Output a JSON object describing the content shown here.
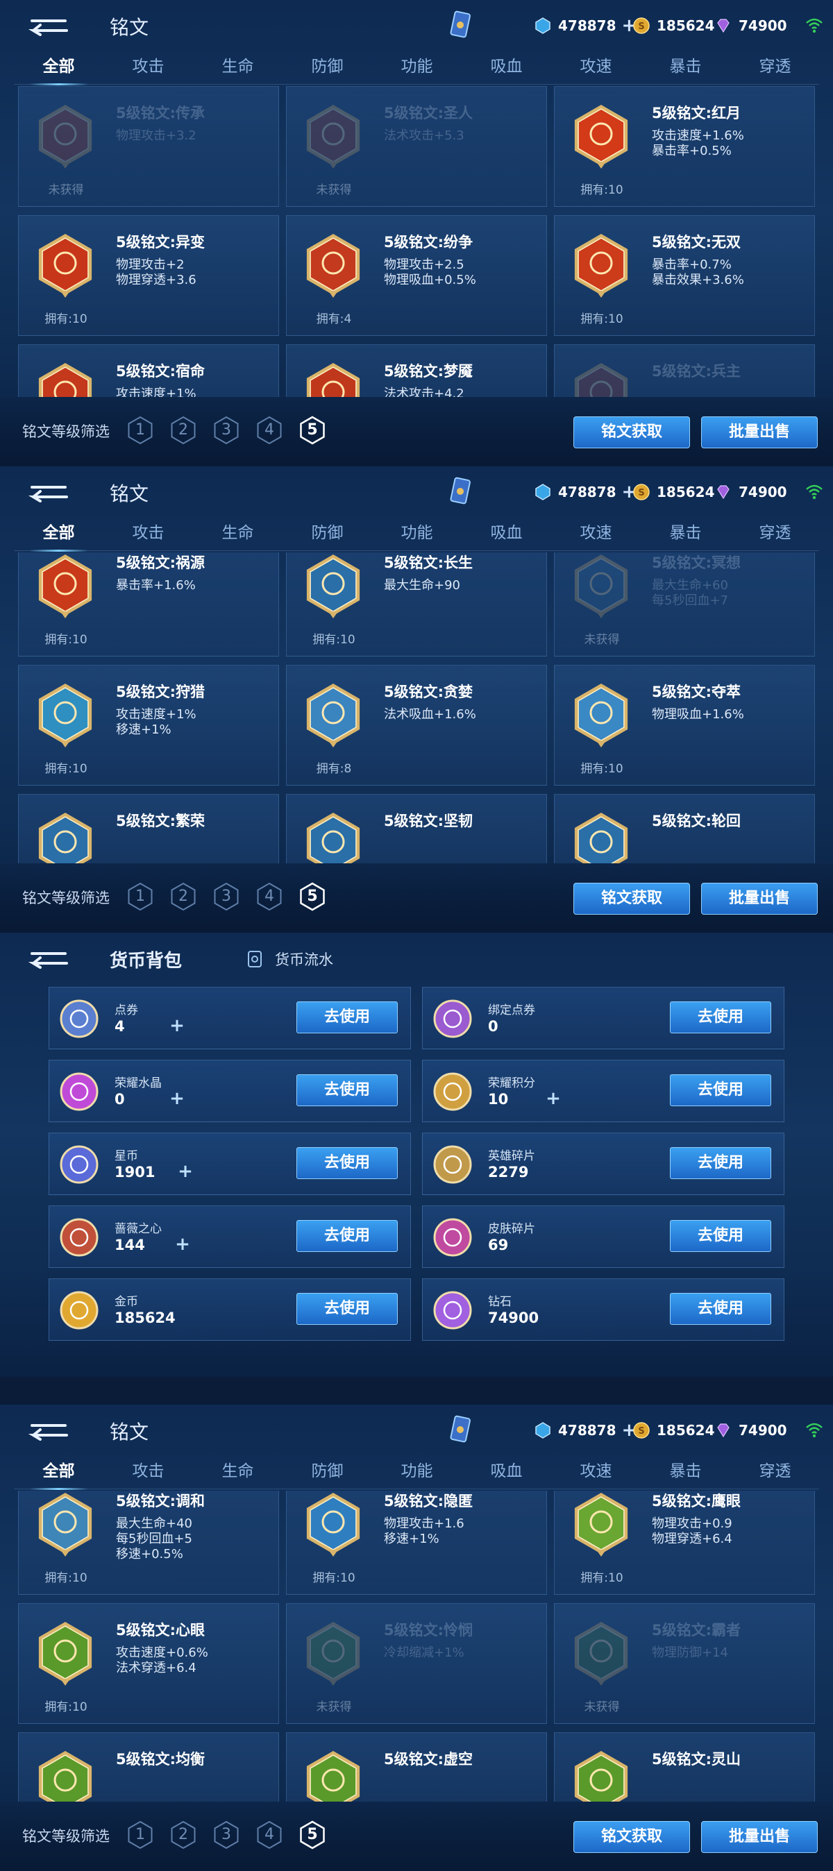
{
  "header": {
    "title": "铭文",
    "gems": "478878",
    "gold": "185624",
    "diamonds": "74900"
  },
  "tabs": [
    "全部",
    "攻击",
    "生命",
    "防御",
    "功能",
    "吸血",
    "攻速",
    "暴击",
    "穿透"
  ],
  "bottom": {
    "filter_label": "铭文等级筛选",
    "levels": [
      "1",
      "2",
      "3",
      "4",
      "5"
    ],
    "selected_level": "5",
    "acquire": "铭文获取",
    "sell": "批量出售"
  },
  "panels": [
    {
      "cards": [
        {
          "name": "5级铭文:传承",
          "stats": [
            "物理攻击+3.2"
          ],
          "own": "未获得",
          "owned": false,
          "color": "#b03a24"
        },
        {
          "name": "5级铭文:圣人",
          "stats": [
            "法术攻击+5.3"
          ],
          "own": "未获得",
          "owned": false,
          "color": "#a03a30"
        },
        {
          "name": "5级铭文:红月",
          "stats": [
            "攻击速度+1.6%",
            "暴击率+0.5%"
          ],
          "own": "拥有:10",
          "owned": true,
          "color": "#d23a18"
        },
        {
          "name": "5级铭文:异变",
          "stats": [
            "物理攻击+2",
            "物理穿透+3.6"
          ],
          "own": "拥有:10",
          "owned": true,
          "color": "#c8361a"
        },
        {
          "name": "5级铭文:纷争",
          "stats": [
            "物理攻击+2.5",
            "物理吸血+0.5%"
          ],
          "own": "拥有:4",
          "owned": true,
          "color": "#c33a1e"
        },
        {
          "name": "5级铭文:无双",
          "stats": [
            "暴击率+0.7%",
            "暴击效果+3.6%"
          ],
          "own": "拥有:10",
          "owned": true,
          "color": "#cc3b1a"
        },
        {
          "name": "5级铭文:宿命",
          "stats": [
            "攻击速度+1%"
          ],
          "own": "",
          "owned": true,
          "color": "#c4381c"
        },
        {
          "name": "5级铭文:梦魇",
          "stats": [
            "法术攻击+4.2"
          ],
          "own": "",
          "owned": true,
          "color": "#c0381c"
        },
        {
          "name": "5级铭文:兵主",
          "stats": [
            ""
          ],
          "own": "",
          "owned": false,
          "color": "#a03a30"
        }
      ]
    },
    {
      "cards": [
        {
          "name": "5级铭文:祸源",
          "stats": [
            "暴击率+1.6%"
          ],
          "own": "拥有:10",
          "owned": true,
          "color": "#c93a1a"
        },
        {
          "name": "5级铭文:长生",
          "stats": [
            "最大生命+90"
          ],
          "own": "拥有:10",
          "owned": true,
          "color": "#2a6fa8"
        },
        {
          "name": "5级铭文:冥想",
          "stats": [
            "最大生命+60",
            "每5秒回血+7"
          ],
          "own": "未获得",
          "owned": false,
          "color": "#2f6a9c"
        },
        {
          "name": "5级铭文:狩猎",
          "stats": [
            "攻击速度+1%",
            "移速+1%"
          ],
          "own": "拥有:10",
          "owned": true,
          "color": "#2e8fc0"
        },
        {
          "name": "5级铭文:贪婪",
          "stats": [
            "法术吸血+1.6%"
          ],
          "own": "拥有:8",
          "owned": true,
          "color": "#3a84c0"
        },
        {
          "name": "5级铭文:夺萃",
          "stats": [
            "物理吸血+1.6%"
          ],
          "own": "拥有:10",
          "owned": true,
          "color": "#3a88c4"
        },
        {
          "name": "5级铭文:繁荣",
          "stats": [
            ""
          ],
          "own": "",
          "owned": true,
          "color": "#2a6fa8"
        },
        {
          "name": "5级铭文:坚韧",
          "stats": [
            ""
          ],
          "own": "",
          "owned": true,
          "color": "#2a6fa8"
        },
        {
          "name": "5级铭文:轮回",
          "stats": [
            ""
          ],
          "own": "",
          "owned": true,
          "color": "#2a6fa8"
        }
      ]
    },
    {
      "cards": [
        {
          "name": "5级铭文:调和",
          "stats": [
            "最大生命+40",
            "每5秒回血+5",
            "移速+0.5%"
          ],
          "own": "拥有:10",
          "owned": true,
          "color": "#3f86b8"
        },
        {
          "name": "5级铭文:隐匿",
          "stats": [
            "物理攻击+1.6",
            "移速+1%"
          ],
          "own": "拥有:10",
          "owned": true,
          "color": "#2f7fc0"
        },
        {
          "name": "5级铭文:鹰眼",
          "stats": [
            "物理攻击+0.9",
            "物理穿透+6.4"
          ],
          "own": "拥有:10",
          "owned": true,
          "color": "#6aa632"
        },
        {
          "name": "5级铭文:心眼",
          "stats": [
            "攻击速度+0.6%",
            "法术穿透+6.4"
          ],
          "own": "拥有:10",
          "owned": true,
          "color": "#5a9a2a"
        },
        {
          "name": "5级铭文:怜悯",
          "stats": [
            "冷却缩减+1%"
          ],
          "own": "未获得",
          "owned": false,
          "color": "#4a8a3a"
        },
        {
          "name": "5级铭文:霸者",
          "stats": [
            "物理防御+14"
          ],
          "own": "未获得",
          "owned": false,
          "color": "#3e7a3a"
        },
        {
          "name": "5级铭文:均衡",
          "stats": [
            ""
          ],
          "own": "",
          "owned": true,
          "color": "#5a9a2a"
        },
        {
          "name": "5级铭文:虚空",
          "stats": [
            ""
          ],
          "own": "",
          "owned": true,
          "color": "#5a9a2a"
        },
        {
          "name": "5级铭文:灵山",
          "stats": [
            ""
          ],
          "own": "",
          "owned": true,
          "color": "#5a9a2a"
        }
      ]
    }
  ],
  "wallet": {
    "title": "货币背包",
    "flow": "货币流水",
    "use_label": "去使用",
    "items": [
      {
        "name": "点券",
        "value": "4",
        "plus": true,
        "icon": "coupon-icon",
        "color": "#5a7fd0"
      },
      {
        "name": "绑定点券",
        "value": "0",
        "plus": false,
        "icon": "bound-coupon-icon",
        "color": "#9a5ad0"
      },
      {
        "name": "荣耀水晶",
        "value": "0",
        "plus": true,
        "icon": "glory-crystal-icon",
        "color": "#c04ad8"
      },
      {
        "name": "荣耀积分",
        "value": "10",
        "plus": true,
        "icon": "glory-points-icon",
        "color": "#d0a040"
      },
      {
        "name": "星币",
        "value": "1901",
        "plus": true,
        "icon": "star-coin-icon",
        "color": "#5a6ad8"
      },
      {
        "name": "英雄碎片",
        "value": "2279",
        "plus": false,
        "icon": "hero-fragment-icon",
        "color": "#c09a4a"
      },
      {
        "name": "蔷薇之心",
        "value": "144",
        "plus": true,
        "icon": "rose-heart-icon",
        "color": "#c0503a"
      },
      {
        "name": "皮肤碎片",
        "value": "69",
        "plus": false,
        "icon": "skin-fragment-icon",
        "color": "#c04aa0"
      },
      {
        "name": "金币",
        "value": "185624",
        "plus": false,
        "icon": "gold-coin-icon",
        "color": "#e0a830"
      },
      {
        "name": "钻石",
        "value": "74900",
        "plus": false,
        "icon": "diamond-icon",
        "color": "#a060e0"
      }
    ]
  }
}
